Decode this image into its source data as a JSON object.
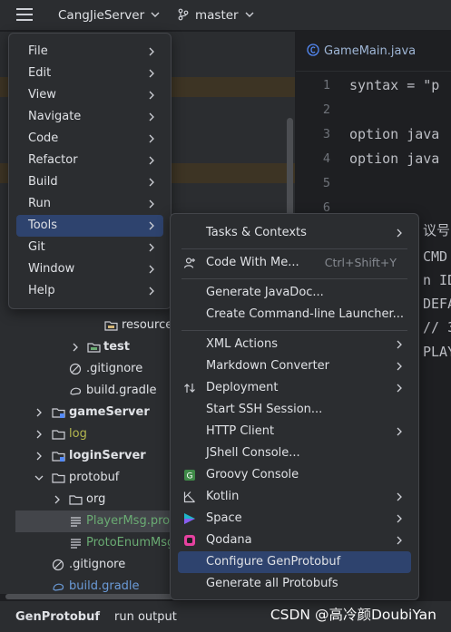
{
  "topbar": {
    "project": "CangJieServer",
    "branch": "master"
  },
  "tree": {
    "resources": "resource",
    "test": "test",
    "gitignore1": ".gitignore",
    "build_gradle1": "build.gradle",
    "gameServer": "gameServer",
    "log": "log",
    "loginServer": "loginServer",
    "protobuf": "protobuf",
    "org": "org",
    "playermsg": "PlayerMsg.pro",
    "protoenum": "ProtoEnumMsg",
    "gitignore2": ".gitignore",
    "build_gradle2": "build.gradle"
  },
  "editor": {
    "tab": "GameMain.java",
    "line_numbers": [
      "1",
      "2",
      "3",
      "4",
      "5",
      "6"
    ],
    "lines": [
      "syntax = \"p",
      "",
      "option java",
      "option java",
      "",
      ""
    ],
    "fragments": [
      "议号",
      "CMD",
      "n ID",
      "DEFA",
      "// 3",
      "PLAY"
    ]
  },
  "main_menu": [
    "File",
    "Edit",
    "View",
    "Navigate",
    "Code",
    "Refactor",
    "Build",
    "Run",
    "Tools",
    "Git",
    "Window",
    "Help"
  ],
  "tools_menu": {
    "tasks": "Tasks & Contexts",
    "code_with_me": "Code With Me...",
    "code_with_me_shortcut": "Ctrl+Shift+Y",
    "javadoc": "Generate JavaDoc...",
    "launcher": "Create Command-line Launcher...",
    "xml": "XML Actions",
    "markdown": "Markdown Converter",
    "deployment": "Deployment",
    "ssh": "Start SSH Session...",
    "http": "HTTP Client",
    "jshell": "JShell Console...",
    "groovy": "Groovy Console",
    "kotlin": "Kotlin",
    "space": "Space",
    "qodana": "Qodana",
    "configure": "Configure GenProtobuf",
    "generate_all": "Generate all Protobufs"
  },
  "bottombar": {
    "tool1": "GenProtobuf",
    "tool2": "run output"
  },
  "watermark": "CSDN @高冷颜DoubiYan",
  "colors": {
    "accent": "#2e436e",
    "folder": "#ced0d6",
    "green_file": "#6aab73",
    "log_yellow": "#b5b84f"
  }
}
